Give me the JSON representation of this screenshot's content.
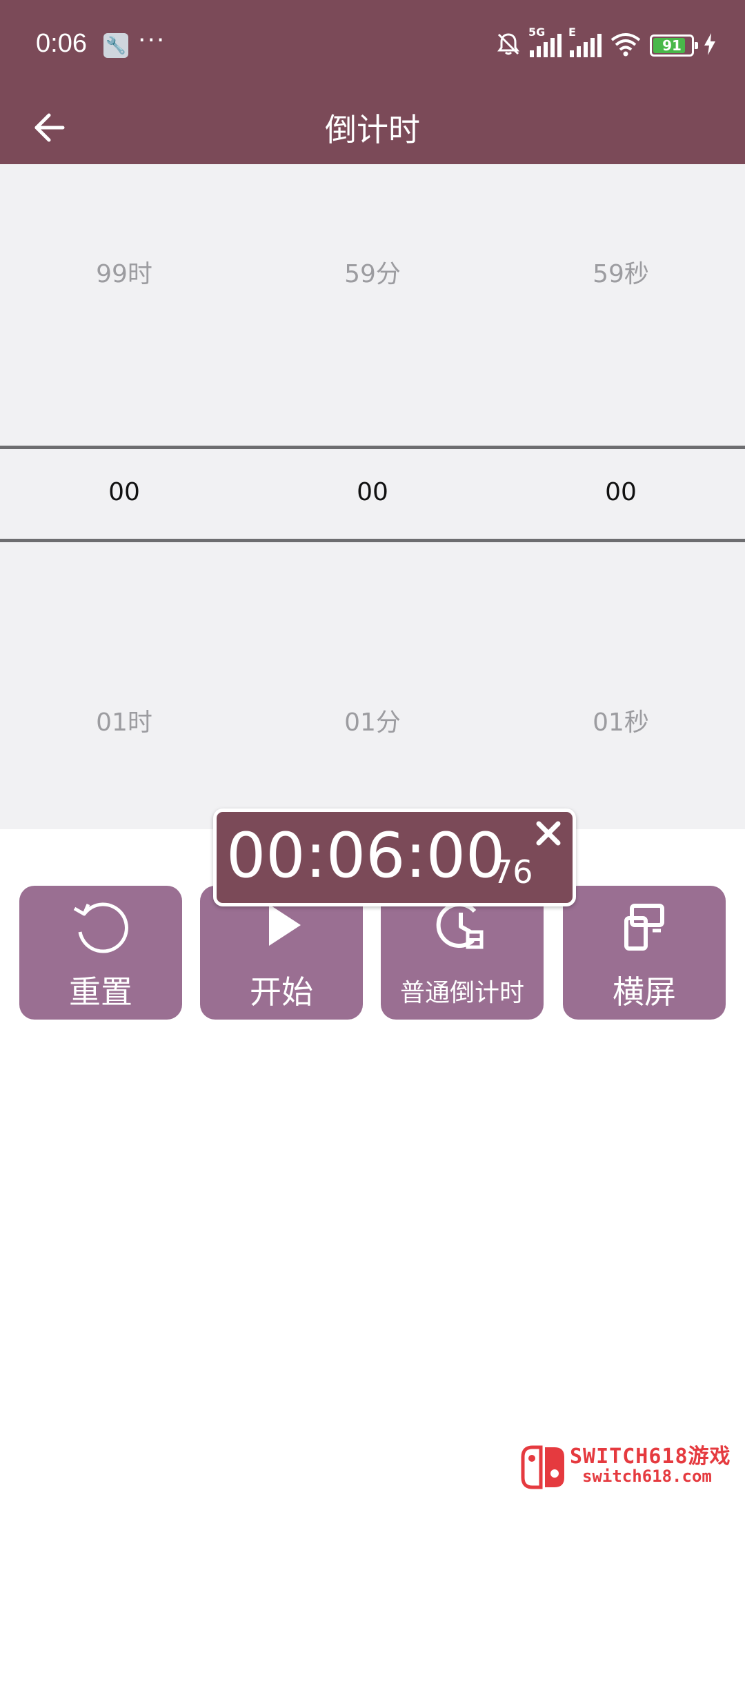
{
  "status_bar": {
    "time": "0:06",
    "more": "···",
    "battery_level": "91",
    "signal_tags": [
      "5G",
      "E"
    ],
    "icons": [
      "wrench-icon",
      "mute-bell-icon",
      "signal-icon",
      "wifi-icon",
      "battery-icon",
      "charging-icon"
    ]
  },
  "app_bar": {
    "title": "倒计时"
  },
  "picker": {
    "above": [
      "99时",
      "59分",
      "59秒"
    ],
    "selected": [
      "00",
      "00",
      "00"
    ],
    "below": [
      "01时",
      "01分",
      "01秒"
    ]
  },
  "floating_timer": {
    "time": "00:06:00",
    "centiseconds": "76"
  },
  "buttons": [
    {
      "label": "重置",
      "icon": "reset-icon"
    },
    {
      "label": "开始",
      "icon": "play-icon"
    },
    {
      "label": "普通倒计时",
      "icon": "clock-icon"
    },
    {
      "label": "横屏",
      "icon": "rotate-screen-icon"
    }
  ],
  "watermark": {
    "line1": "SWITCH618游戏",
    "line2": "switch618.com"
  },
  "colors": {
    "primary": "#7b4a58",
    "button": "#9a6f92",
    "picker_bg": "#f1f1f3",
    "watermark": "#e53a3f"
  }
}
